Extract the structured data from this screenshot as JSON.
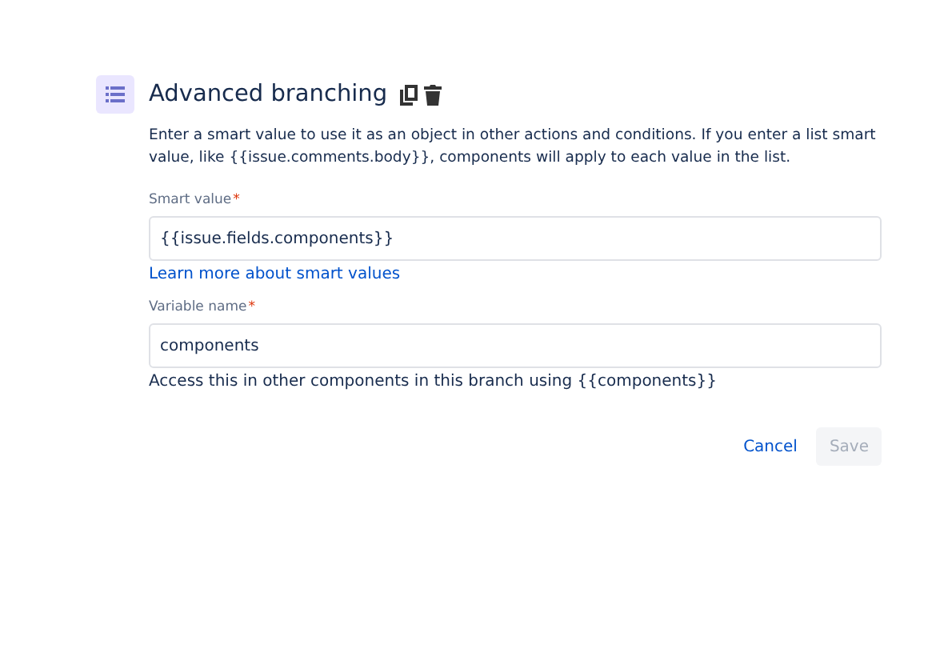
{
  "title": "Advanced branching",
  "description": "Enter a smart value to use it as an object in other actions and conditions. If you enter a list smart value, like {{issue.comments.body}}, components will apply to each value in the list.",
  "fields": [
    {
      "label": "Smart value",
      "required_mark": "*",
      "value": "{{issue.fields.components}}",
      "help": "Learn more about smart values",
      "kind": "link"
    },
    {
      "label": "Variable name",
      "required_mark": "*",
      "value": "components",
      "help": "Access this in other components in this branch using {{components}}",
      "kind": "text"
    }
  ],
  "buttons": [
    {
      "label": "Cancel",
      "kind": "subtle",
      "disabled": false
    },
    {
      "label": "Save",
      "kind": "primary",
      "disabled": true
    }
  ]
}
